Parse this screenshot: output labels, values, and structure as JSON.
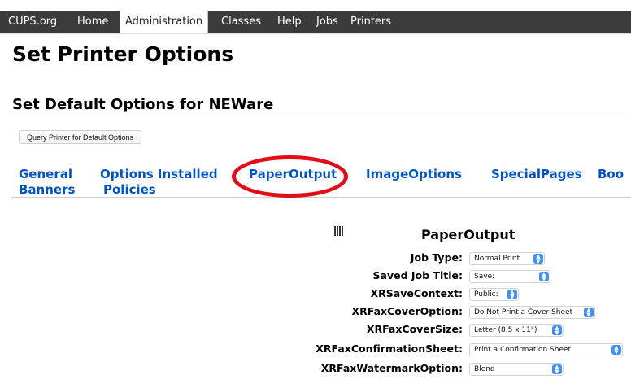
{
  "nav": {
    "site": "CUPS.org",
    "items": [
      "Home",
      "Administration",
      "Classes",
      "Help",
      "Jobs",
      "Printers"
    ],
    "active": "Administration"
  },
  "page_title": "Set Printer Options",
  "section_heading": "Set Default Options for NEWare",
  "query_button": "Query Printer for Default Options",
  "tabs": [
    "General",
    "Banners",
    "Options Installed",
    "Policies",
    "PaperOutput",
    "ImageOptions",
    "SpecialPages",
    "Boo"
  ],
  "panel": {
    "title": "PaperOutput",
    "options": [
      {
        "label": "Job Type:",
        "value": "Normal Print"
      },
      {
        "label": "Saved Job Title:",
        "value": "Save:"
      },
      {
        "label": "XRSaveContext:",
        "value": "Public:"
      },
      {
        "label": "XRFaxCoverOption:",
        "value": "Do Not Print a Cover Sheet"
      },
      {
        "label": "XRFaxCoverSize:",
        "value": "Letter (8.5 x 11\")"
      },
      {
        "label": "XRFaxConfirmationSheet:",
        "value": "Print a Confirmation Sheet"
      },
      {
        "label": "XRFaxWatermarkOption:",
        "value": "Blend"
      }
    ]
  },
  "colors": {
    "nav_bg": "#3b3b3b",
    "link": "#0055c4",
    "annotation": "#e20d17",
    "select_arrow": "#3f8ff7"
  }
}
